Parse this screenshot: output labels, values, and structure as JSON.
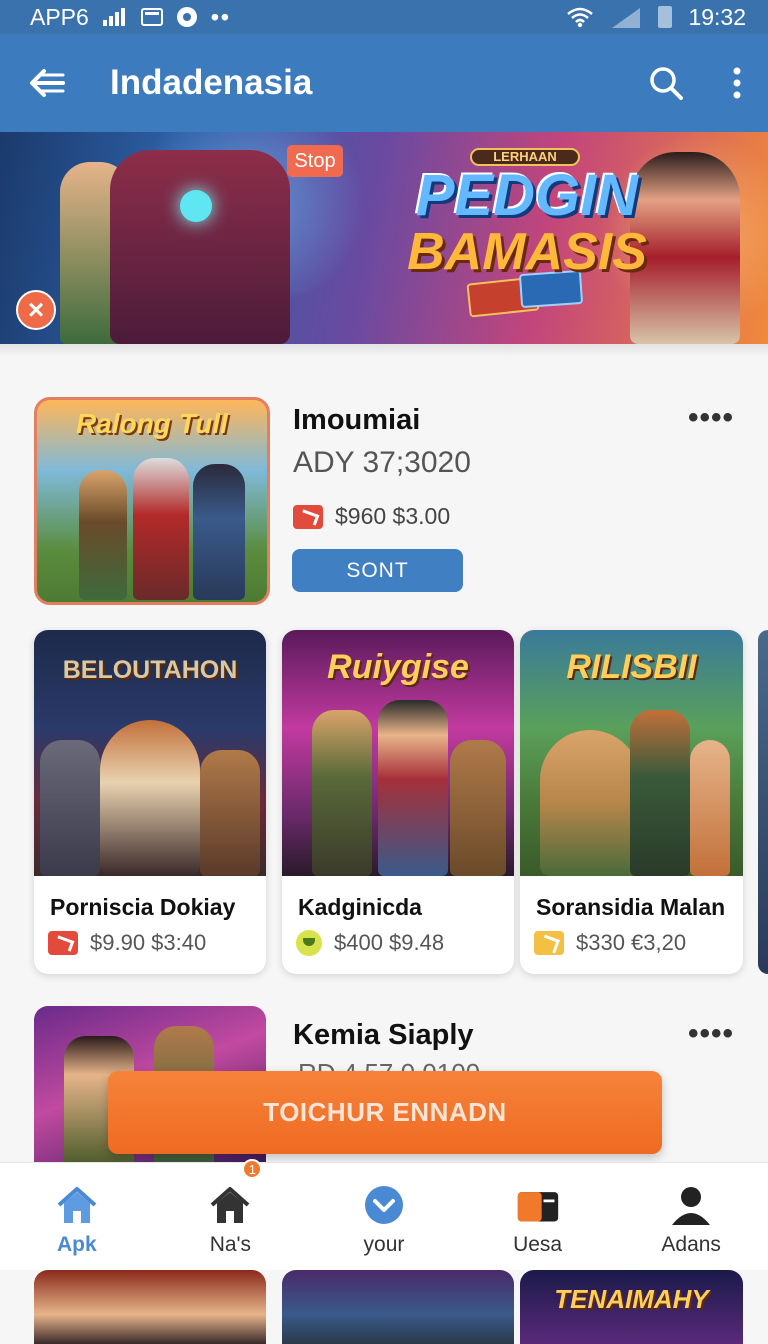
{
  "status_bar": {
    "carrier": "APP6",
    "time": "19:32"
  },
  "app_bar": {
    "title": "Indadenasia"
  },
  "banner": {
    "badge": "Stop",
    "logo_small": "LERHAAN",
    "title_line1": "PEDGIN",
    "title_line2": "BAMASIS"
  },
  "featured": {
    "art_title": "Ralong Tull",
    "title": "Imoumiai",
    "subtitle": "ADY 37;3020",
    "price": "$960 $3.00",
    "button": "SONT"
  },
  "cards": [
    {
      "art_title": "BELOUTAHON",
      "name": "Porniscia Dokiay",
      "price": "$9.90 $3:40",
      "icon": "red-tag-icon"
    },
    {
      "art_title": "Ruiygise",
      "name": "Kadginicda",
      "price": "$400 $9.48",
      "icon": "smiley-icon"
    },
    {
      "art_title": "RILISBII",
      "name": "Soransidia Malan",
      "price": "$330 €3,20",
      "icon": "yellow-tag-icon"
    }
  ],
  "featured2": {
    "title": "Kemia Siaply",
    "subtitle": "RD 4 57 0 0100"
  },
  "cta": {
    "label": "TOICHUR ENNADN"
  },
  "bottom_nav": [
    {
      "label": "Apk",
      "icon": "home-icon",
      "active": true
    },
    {
      "label": "Na's",
      "icon": "store-icon",
      "badge": "1"
    },
    {
      "label": "your",
      "icon": "chevron-down-circle-icon"
    },
    {
      "label": "Uesa",
      "icon": "wallet-icon"
    },
    {
      "label": "Adans",
      "icon": "person-icon"
    }
  ],
  "bottom_peeks": [
    {
      "art_title": ""
    },
    {
      "art_title": ""
    },
    {
      "art_title": "TENAIMAHY"
    }
  ],
  "colors": {
    "primary": "#3d7bbf",
    "status_bar": "#3a72ad",
    "accent_orange": "#ef6a22",
    "button_blue": "#3f7fc2",
    "active_nav": "#4a89d4"
  }
}
